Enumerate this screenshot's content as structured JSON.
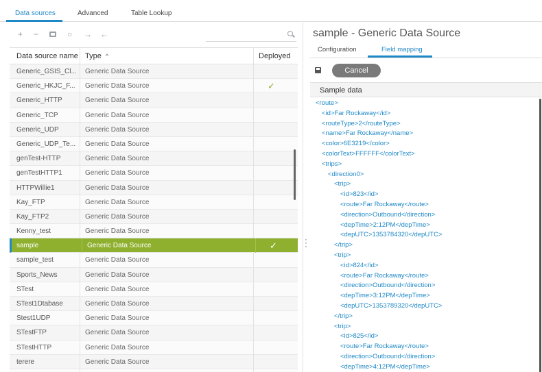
{
  "top_tabs": [
    {
      "label": "Data sources"
    },
    {
      "label": "Advanced"
    },
    {
      "label": "Table Lookup"
    }
  ],
  "toolbar": {
    "icons": [
      "plus-icon",
      "minus-icon",
      "copy-icon",
      "refresh-icon",
      "deploy-icon",
      "undeploy-icon"
    ],
    "glyphs": [
      "+",
      "−",
      "",
      "○",
      "→",
      "←"
    ]
  },
  "table": {
    "columns": {
      "name": "Data source name",
      "type": "Type",
      "sort": "^",
      "deployed": "Deployed"
    },
    "rows": [
      {
        "name": "Generic_GSIS_Cl...",
        "type": "Generic Data Source",
        "deployed": ""
      },
      {
        "name": "Generic_HKJC_F...",
        "type": "Generic Data Source",
        "deployed": "✓"
      },
      {
        "name": "Generic_HTTP",
        "type": "Generic Data Source",
        "deployed": ""
      },
      {
        "name": "Generic_TCP",
        "type": "Generic Data Source",
        "deployed": ""
      },
      {
        "name": "Generic_UDP",
        "type": "Generic Data Source",
        "deployed": ""
      },
      {
        "name": "Generic_UDP_Te...",
        "type": "Generic Data Source",
        "deployed": ""
      },
      {
        "name": "genTest-HTTP",
        "type": "Generic Data Source",
        "deployed": ""
      },
      {
        "name": "genTestHTTP1",
        "type": "Generic Data Source",
        "deployed": ""
      },
      {
        "name": "HTTPWillie1",
        "type": "Generic Data Source",
        "deployed": ""
      },
      {
        "name": "Kay_FTP",
        "type": "Generic Data Source",
        "deployed": ""
      },
      {
        "name": "Kay_FTP2",
        "type": "Generic Data Source",
        "deployed": ""
      },
      {
        "name": "Kenny_test",
        "type": "Generic Data Source",
        "deployed": ""
      },
      {
        "name": "sample",
        "type": "Generic Data Source",
        "deployed": "✓",
        "selected": true
      },
      {
        "name": "sample_test",
        "type": "Generic Data Source",
        "deployed": ""
      },
      {
        "name": "Sports_News",
        "type": "Generic Data Source",
        "deployed": ""
      },
      {
        "name": "STest",
        "type": "Generic Data Source",
        "deployed": ""
      },
      {
        "name": "STest1Dtabase",
        "type": "Generic Data Source",
        "deployed": ""
      },
      {
        "name": "Stest1UDP",
        "type": "Generic Data Source",
        "deployed": ""
      },
      {
        "name": "STestFTP",
        "type": "Generic Data Source",
        "deployed": ""
      },
      {
        "name": "STestHTTP",
        "type": "Generic Data Source",
        "deployed": ""
      },
      {
        "name": "terere",
        "type": "Generic Data Source",
        "deployed": ""
      },
      {
        "name": "",
        "type": "",
        "deployed": ""
      }
    ]
  },
  "detail": {
    "title": "sample - Generic Data Source",
    "tabs": [
      {
        "label": "Configuration"
      },
      {
        "label": "Field mapping"
      }
    ],
    "cancel_label": "Cancel",
    "sample_label": "Sample data",
    "xml_lines": [
      {
        "indent": 0,
        "text": "<route>"
      },
      {
        "indent": 1,
        "text": "<id>Far Rockaway</id>"
      },
      {
        "indent": 1,
        "text": "<routeType>2</routeType>"
      },
      {
        "indent": 1,
        "text": "<name>Far Rockaway</name>"
      },
      {
        "indent": 1,
        "text": "<color>6E3219</color>"
      },
      {
        "indent": 1,
        "text": "<colorText>FFFFFF</colorText>"
      },
      {
        "indent": 1,
        "text": "<trips>"
      },
      {
        "indent": 2,
        "text": "<direction0>"
      },
      {
        "indent": 3,
        "text": "<trip>"
      },
      {
        "indent": 4,
        "text": "<id>823</id>"
      },
      {
        "indent": 4,
        "text": "<route>Far Rockaway</route>"
      },
      {
        "indent": 4,
        "text": "<direction>Outbound</direction>"
      },
      {
        "indent": 4,
        "text": "<depTime>2:12PM</depTime>"
      },
      {
        "indent": 4,
        "text": "<depUTC>1353784320</depUTC>"
      },
      {
        "indent": 3,
        "text": "</trip>"
      },
      {
        "indent": 3,
        "text": "<trip>"
      },
      {
        "indent": 4,
        "text": "<id>824</id>"
      },
      {
        "indent": 4,
        "text": "<route>Far Rockaway</route>"
      },
      {
        "indent": 4,
        "text": "<direction>Outbound</direction>"
      },
      {
        "indent": 4,
        "text": "<depTime>3:12PM</depTime>"
      },
      {
        "indent": 4,
        "text": "<depUTC>1353789320</depUTC>"
      },
      {
        "indent": 3,
        "text": "</trip>"
      },
      {
        "indent": 3,
        "text": "<trip>"
      },
      {
        "indent": 4,
        "text": "<id>825</id>"
      },
      {
        "indent": 4,
        "text": "<route>Far Rockaway</route>"
      },
      {
        "indent": 4,
        "text": "<direction>Outbound</direction>"
      },
      {
        "indent": 4,
        "text": "<depTime>4:12PM</depTime>"
      }
    ]
  },
  "colors": {
    "accent": "#1e88c7",
    "selected_row": "#8fb02f",
    "deployed_check": "#8fb02f"
  }
}
